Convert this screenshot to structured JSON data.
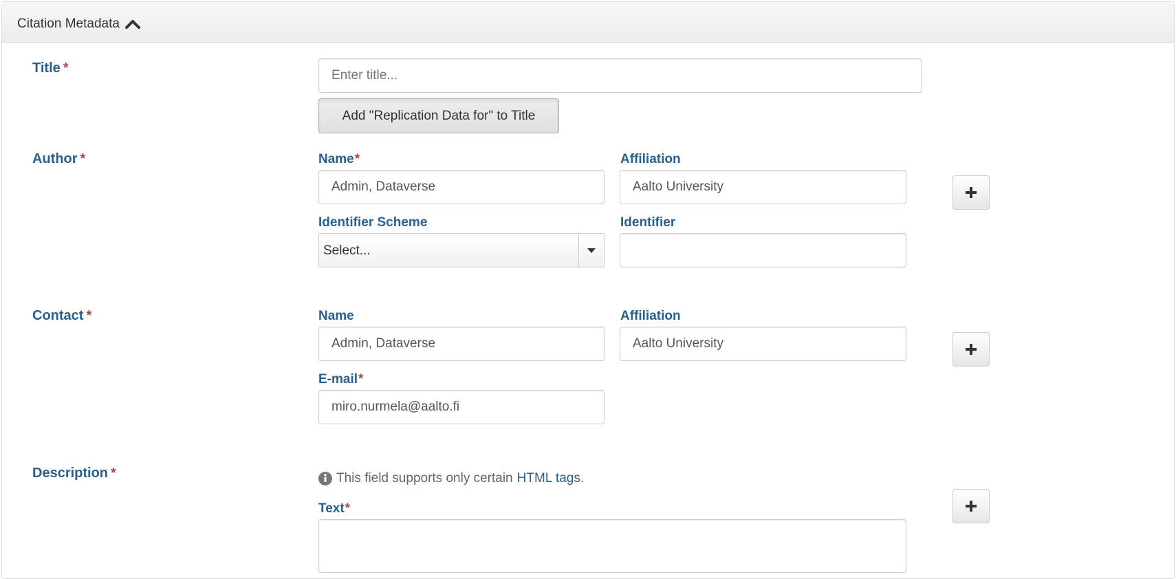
{
  "panel": {
    "title": "Citation Metadata"
  },
  "title_field": {
    "label": "Title",
    "required_mark": "*",
    "placeholder": "Enter title...",
    "replication_button": "Add \"Replication Data for\" to Title"
  },
  "author": {
    "label": "Author",
    "required_mark": "*",
    "name_label": "Name",
    "name_required_mark": "*",
    "name_value": "Admin, Dataverse",
    "affiliation_label": "Affiliation",
    "affiliation_value": "Aalto University",
    "identifier_scheme_label": "Identifier Scheme",
    "identifier_scheme_value": "Select...",
    "identifier_label": "Identifier",
    "identifier_value": "",
    "add_button": "+"
  },
  "contact": {
    "label": "Contact",
    "required_mark": "*",
    "name_label": "Name",
    "name_value": "Admin, Dataverse",
    "affiliation_label": "Affiliation",
    "affiliation_value": "Aalto University",
    "email_label": "E-mail",
    "email_required_mark": "*",
    "email_value": "miro.nurmela@aalto.fi",
    "add_button": "+"
  },
  "description": {
    "label": "Description",
    "required_mark": "*",
    "help_text": "This field supports only certain",
    "help_link": "HTML tags",
    "help_suffix": ".",
    "text_label": "Text",
    "text_required_mark": "*",
    "text_value": "",
    "add_button": "+"
  },
  "colors": {
    "label_blue": "#286090",
    "required_red": "#a94442"
  }
}
